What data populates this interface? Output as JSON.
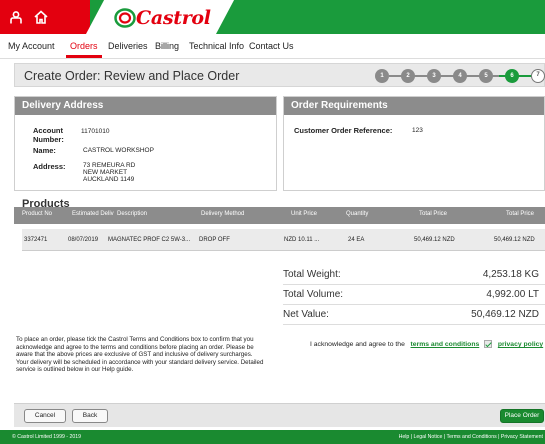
{
  "brand": {
    "logo_text": "Castrol",
    "accent": "#e3000f",
    "green": "#1a9b3c"
  },
  "nav": {
    "items": [
      "My Account",
      "Orders",
      "Deliveries",
      "Billing",
      "Technical Info",
      "Contact Us"
    ],
    "active": "Orders"
  },
  "page": {
    "title": "Create Order:  Review and Place Order"
  },
  "steps": {
    "labels": [
      "1",
      "2",
      "3",
      "4",
      "5",
      "6",
      "7"
    ],
    "current": 6
  },
  "delivery": {
    "title": "Delivery Address",
    "account_label": "Account Number:",
    "account_value": "11701010",
    "name_label": "Name:",
    "name_value": "CASTROL WORKSHOP",
    "address_label": "Address:",
    "address_lines": [
      "73 REMEURA RD",
      "NEW MARKET",
      "AUCKLAND 1149"
    ]
  },
  "requirements": {
    "title": "Order Requirements",
    "ref_label": "Customer Order Reference:",
    "ref_value": "123"
  },
  "products": {
    "title": "Products",
    "columns": [
      "Product No",
      "Estimated Deliv",
      "Description",
      "Delivery Method",
      "Unit Price",
      "Quantity",
      "Total Price",
      "Total Price"
    ],
    "rows": [
      [
        "3372471",
        "08/07/2019",
        "MAGNATEC PROF C2 5W-3...",
        "DROP OFF",
        "NZD 10.11 ...",
        "24 EA",
        "50,469.12 NZD",
        "50,469.12 NZD"
      ]
    ]
  },
  "totals": {
    "weight_label": "Total Weight:",
    "weight_value": "4,253.18 KG",
    "volume_label": "Total Volume:",
    "volume_value": "4,992.00 LT",
    "net_label": "Net Value:",
    "net_value": "50,469.12 NZD"
  },
  "terms": {
    "text": "To place an order, please tick the Castrol Terms and Conditions box to confirm that you acknowledge and agree to the terms and conditions before placing an order. Please be aware that the above prices are exclusive of GST and inclusive of delivery surcharges. Your delivery will be scheduled in accordance with your standard delivery service. Detailed service is outlined below in our Help guide.",
    "ack_text": "I acknowledge and agree to the",
    "terms_link": "terms and conditions",
    "privacy_link": "privacy policy"
  },
  "buttons": {
    "cancel": "Cancel",
    "back": "Back",
    "place": "Place Order"
  },
  "footer": {
    "copyright": "© Castrol Limited 1999 - 2019",
    "links": "Help  |  Legal Notice  |  Terms and Conditions  |  Privacy Statement"
  }
}
